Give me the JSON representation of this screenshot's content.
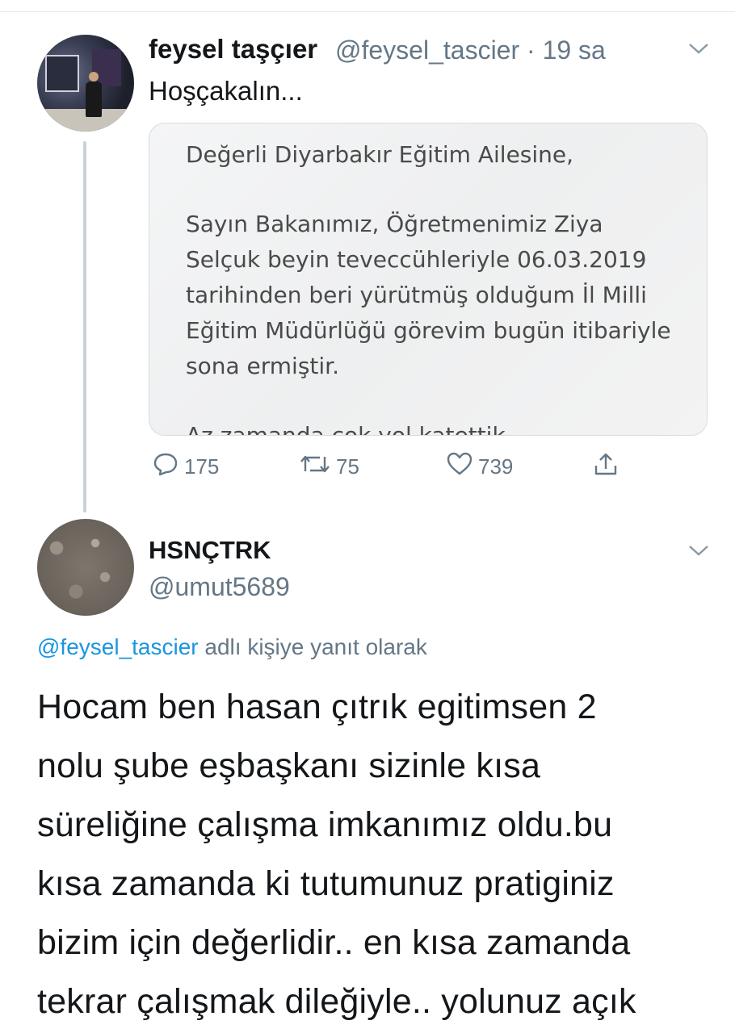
{
  "tweet1": {
    "display_name": "feysel taşçıer",
    "handle": "@feysel_tascier",
    "time": "· 19 sa",
    "text": "Hoşçakalın...",
    "media_lines": [
      "Değerli Diyarbakır Eğitim Ailesine,",
      "Sayın Bakanımız, Öğretmenimiz Ziya",
      "Selçuk beyin teveccühleriyle 06.03.2019",
      "tarihinden beri yürütmüş olduğum İl Milli",
      "Eğitim Müdürlüğü görevim bugün itibariyle",
      "sona ermiştir.",
      "Az zamanda çok yol katettik"
    ],
    "actions": {
      "replies": "175",
      "retweets": "75",
      "likes": "739"
    }
  },
  "tweet2": {
    "display_name": "HSNÇTRK",
    "handle": "@umut5689",
    "reply_to_handle": "@feysel_tascier",
    "reply_to_suffix": "adlı kişiye yanıt olarak",
    "body_lines": [
      "Hocam ben hasan çıtrık egitimsen 2",
      "nolu şube eşbaşkanı sizinle kısa",
      "süreliğine çalışma imkanımız oldu.bu",
      "kısa zamanda ki tutumunuz pratiginiz",
      "bizim için değerlidir.. en kısa zamanda",
      "tekrar çalışmak dileğiyle.. yolunuz açık"
    ]
  },
  "colors": {
    "link": "#1b95e0",
    "secondary_text": "#657786",
    "thread_line": "#c8d2db"
  },
  "icons": [
    "chevron-down-icon",
    "reply-icon",
    "retweet-icon",
    "like-icon",
    "share-icon"
  ]
}
